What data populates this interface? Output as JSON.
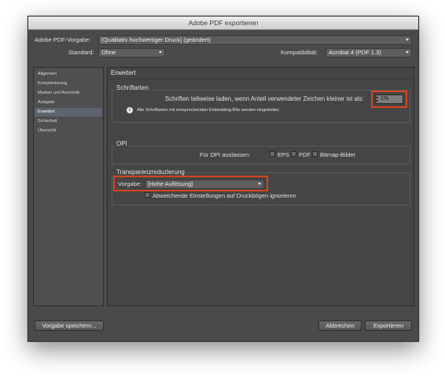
{
  "window": {
    "title": "Adobe PDF exportieren"
  },
  "top": {
    "preset_label": "Adobe PDF-Vorgabe:",
    "preset_value": "[Qualitativ hochwertiger Druck] (geändert)",
    "standard_label": "Standard:",
    "standard_value": "Ohne",
    "compat_label": "Kompatibilität:",
    "compat_value": "Acrobat 4 (PDF 1.3)"
  },
  "sidebar": {
    "items": [
      {
        "label": "Allgemein"
      },
      {
        "label": "Komprimierung"
      },
      {
        "label": "Marken und Anschnitt"
      },
      {
        "label": "Ausgabe"
      },
      {
        "label": "Erweitert",
        "active": true
      },
      {
        "label": "Sicherheit"
      },
      {
        "label": "Übersicht"
      }
    ]
  },
  "main": {
    "title": "Erweitert",
    "fonts": {
      "label": "Schriftarten",
      "subset_text": "Schriften teilweise laden, wenn Anteil verwendeter Zeichen kleiner ist als:",
      "subset_value": "1",
      "subset_unit": "%",
      "info_text": "Alle Schriftarten mit entsprechenden Embedding-Bits werden eingebettet."
    },
    "opi": {
      "label": "OPI",
      "omit_label": "Für OPI auslassen:",
      "options": [
        "EPS",
        "PDF",
        "Bitmap-Bilder"
      ]
    },
    "transparency": {
      "label": "Transparenzreduzierung",
      "preset_label": "Vorgabe:",
      "preset_value": "[Hohe Auflösung]",
      "ignore_label": "Abweichende Einstellungen auf Druckbögen ignorieren"
    }
  },
  "footer": {
    "save_preset": "Vorgabe speichern...",
    "cancel": "Abbrechen",
    "export": "Exportieren"
  },
  "colors": {
    "highlight": "#d9431f",
    "window_bg": "#4a4a4a"
  }
}
